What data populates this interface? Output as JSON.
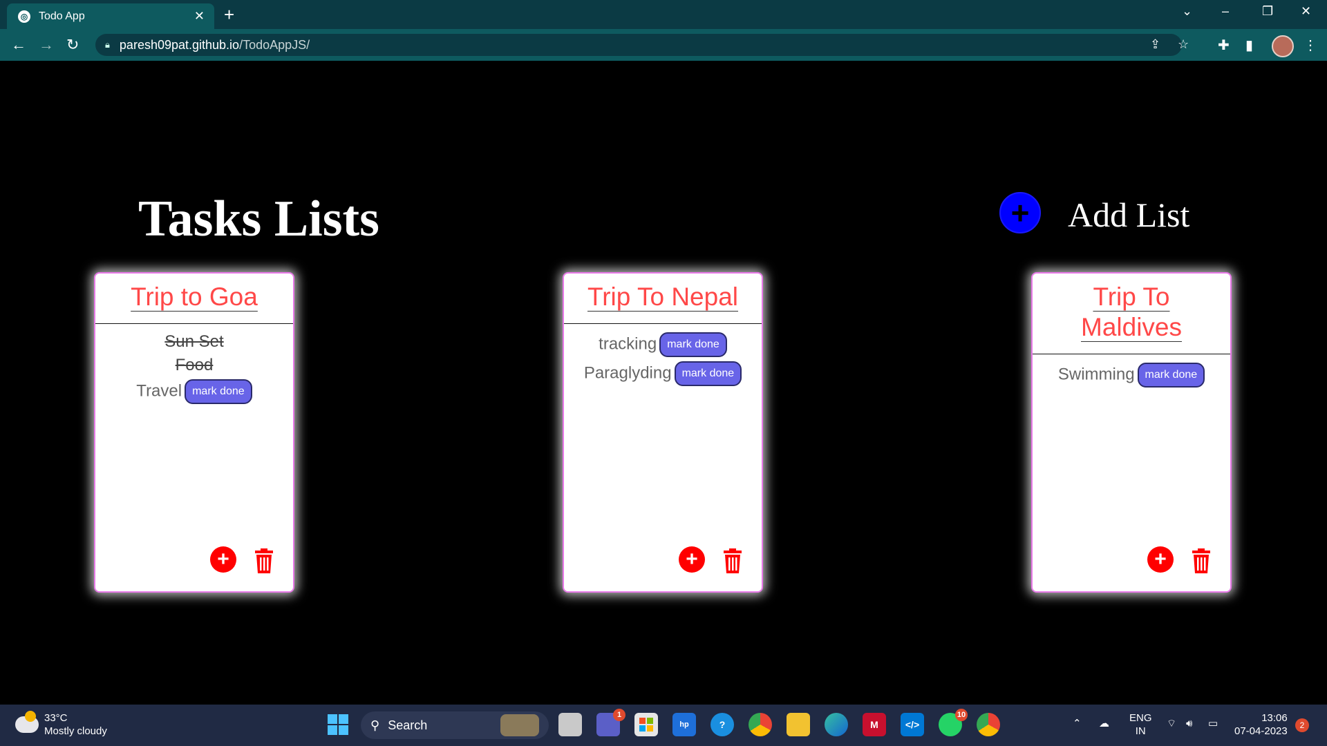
{
  "browser": {
    "tab_title": "Todo App",
    "url_host": "paresh09pat.github.io",
    "url_path": "/TodoAppJS/"
  },
  "page": {
    "title": "Tasks Lists",
    "add_list_label": "Add List",
    "add_list_icon": "plus-icon"
  },
  "lists": [
    {
      "title": "Trip to Goa",
      "items": [
        {
          "text": "Sun Set",
          "done": true
        },
        {
          "text": "Food",
          "done": true
        },
        {
          "text": "Travel",
          "done": false,
          "action": "mark done"
        }
      ]
    },
    {
      "title": "Trip To Nepal",
      "items": [
        {
          "text": "tracking",
          "done": false,
          "action": "mark done"
        },
        {
          "text": "Paraglyding",
          "done": false,
          "action": "mark done"
        }
      ]
    },
    {
      "title": "Trip To Maldives",
      "items": [
        {
          "text": "Swimming",
          "done": false,
          "action": "mark done"
        }
      ]
    }
  ],
  "colors": {
    "accent_red": "#ff0000",
    "title_red": "#ff4848",
    "mark_done_bg": "#6864e8",
    "add_list_blue": "#0000ff"
  },
  "taskbar": {
    "temp": "33°C",
    "weather": "Mostly cloudy",
    "search_label": "Search",
    "teams_badge": "1",
    "whatsapp_badge": "10",
    "lang": "ENG",
    "region": "IN",
    "time": "13:06",
    "date": "07-04-2023",
    "notif_count": "2"
  }
}
